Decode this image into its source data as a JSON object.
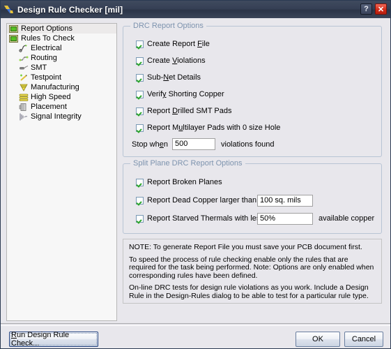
{
  "window": {
    "title": "Design Rule Checker [mil]",
    "icon": "altium-logo-icon",
    "help_label": "?",
    "close_label": "✕"
  },
  "tree": {
    "items": [
      {
        "label": "Report Options",
        "icon": "folder-green-icon",
        "level": 0,
        "selected": true
      },
      {
        "label": "Rules To Check",
        "icon": "folder-green-icon",
        "level": 0,
        "selected": false
      },
      {
        "label": "Electrical",
        "icon": "electrical-icon",
        "level": 1,
        "selected": false
      },
      {
        "label": "Routing",
        "icon": "routing-icon",
        "level": 1,
        "selected": false
      },
      {
        "label": "SMT",
        "icon": "smt-icon",
        "level": 1,
        "selected": false
      },
      {
        "label": "Testpoint",
        "icon": "testpoint-icon",
        "level": 1,
        "selected": false
      },
      {
        "label": "Manufacturing",
        "icon": "manufacturing-icon",
        "level": 1,
        "selected": false
      },
      {
        "label": "High Speed",
        "icon": "high-speed-icon",
        "level": 1,
        "selected": false
      },
      {
        "label": "Placement",
        "icon": "placement-icon",
        "level": 1,
        "selected": false
      },
      {
        "label": "Signal Integrity",
        "icon": "signal-integrity-icon",
        "level": 1,
        "selected": false
      }
    ]
  },
  "drc_group": {
    "legend": "DRC Report Options",
    "checkboxes": [
      {
        "pre": "Create Report ",
        "accel": "F",
        "post": "ile",
        "checked": true
      },
      {
        "pre": "Create ",
        "accel": "V",
        "post": "iolations",
        "checked": true
      },
      {
        "pre": "Sub-",
        "accel": "N",
        "post": "et Details",
        "checked": true
      },
      {
        "pre": "Verif",
        "accel": "y",
        "post": " Shorting Copper",
        "checked": true
      },
      {
        "pre": "Report ",
        "accel": "D",
        "post": "rilled SMT Pads",
        "checked": true
      },
      {
        "pre": "Report M",
        "accel": "u",
        "post": "ltilayer Pads with 0 size Hole",
        "checked": true
      }
    ],
    "stop_when": {
      "label_pre": "Stop wh",
      "label_accel": "e",
      "label_post": "n",
      "value": "500",
      "suffix": "violations found"
    }
  },
  "split_group": {
    "legend": "Split Plane DRC Report Options",
    "rows": [
      {
        "pre": "Report Broken Planes",
        "accel": "",
        "post": "",
        "checked": true,
        "value": null,
        "suffix": ""
      },
      {
        "pre": "Report Dead Copper larger than",
        "accel": "",
        "post": "",
        "checked": true,
        "value": "100 sq. mils",
        "suffix": ""
      },
      {
        "pre": "Report Starved Thermals with less than",
        "accel": "",
        "post": "",
        "checked": true,
        "value": "50%",
        "suffix": "available copper"
      }
    ]
  },
  "note": {
    "line1": "NOTE: To generate Report File you must save your PCB document first.",
    "line2": "To speed the process of rule checking enable only the rules that are required for the task being performed.  Note: Options are only enabled when corresponding rules have been defined.",
    "line3": "On-line DRC tests for design rule violations as you work. Include a Design Rule in the Design-Rules dialog to be able to test for a particular rule  type."
  },
  "buttons": {
    "run_pre": "",
    "run_accel": "R",
    "run_post": "un Design Rule Check...",
    "ok": "OK",
    "cancel": "Cancel"
  },
  "colors": {
    "titlebar": "#36405 5",
    "legend": "#7d93ae",
    "checkmark": "#2ca52c",
    "close_button": "#d32b18"
  }
}
